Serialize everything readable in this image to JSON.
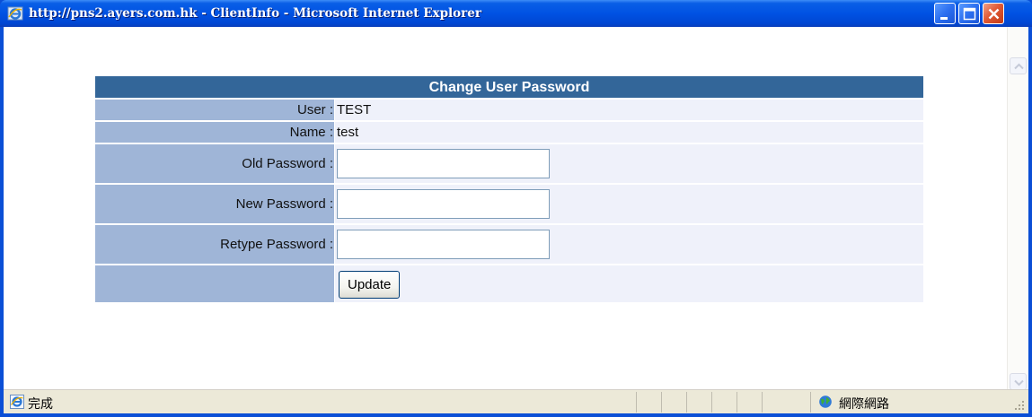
{
  "window": {
    "title": "http://pns2.ayers.com.hk - ClientInfo - Microsoft Internet Explorer"
  },
  "form": {
    "header": "Change User Password",
    "user_label": "User :",
    "user_value": "TEST",
    "name_label": "Name :",
    "name_value": "test",
    "old_password_label": "Old Password :",
    "old_password_value": "",
    "new_password_label": "New Password :",
    "new_password_value": "",
    "retype_password_label": "Retype Password :",
    "retype_password_value": "",
    "update_button": "Update"
  },
  "statusbar": {
    "status_text": "完成",
    "zone_text": "網際網路"
  },
  "colors": {
    "title_bar": "#0052e3",
    "form_header": "#336699",
    "label_cell": "#9fb5d7",
    "value_cell": "#eff1fa",
    "status_bar": "#ece9d8"
  },
  "icons": {
    "title": "ie-icon",
    "minimize": "minimize-icon",
    "maximize": "maximize-icon",
    "close": "close-icon",
    "scroll_up": "chevron-up-icon",
    "scroll_down": "chevron-down-icon",
    "status": "ie-page-icon",
    "zone": "globe-icon",
    "grip": "resize-grip-icon"
  }
}
